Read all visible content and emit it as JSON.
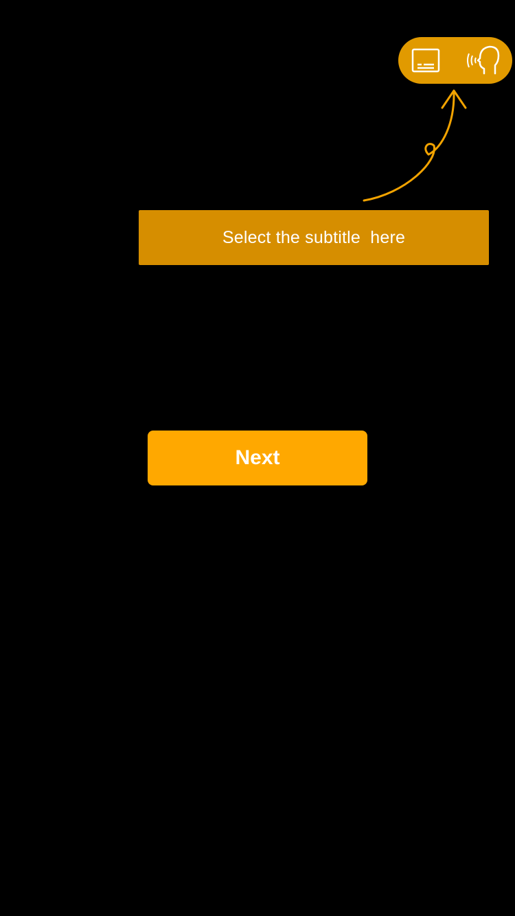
{
  "colors": {
    "background": "#000000",
    "pill": "#E19A00",
    "hint_box": "#D68E00",
    "arrow": "#F2A300",
    "next_button": "#FFA800",
    "text": "#FFFFFF"
  },
  "top_controls": {
    "icons": [
      "subtitles-icon",
      "speaking-head-icon"
    ]
  },
  "hint": {
    "text": "Select the subtitle  here"
  },
  "next_button": {
    "label": "Next"
  }
}
